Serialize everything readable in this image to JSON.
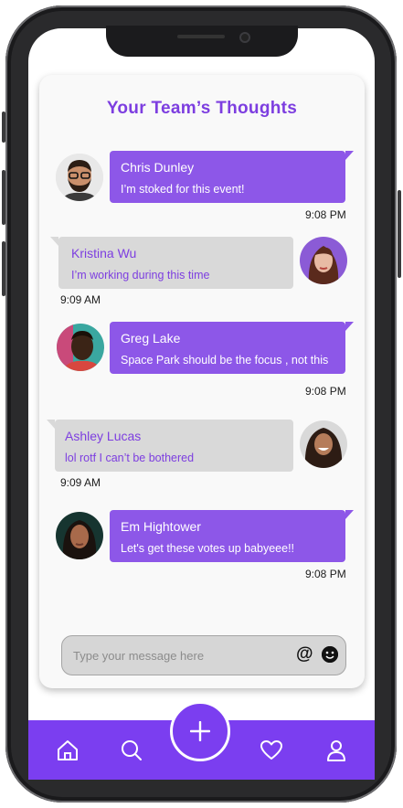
{
  "header": {
    "title": "Your Team’s Thoughts"
  },
  "messages": [
    {
      "sender": "Chris Dunley",
      "text": "I’m stoked for this event!",
      "time": "9:08 PM",
      "side": "left-avatar",
      "style": "purple"
    },
    {
      "sender": "Kristina Wu",
      "text": "I’m working during this time",
      "time": "9:09 AM",
      "side": "right-avatar",
      "style": "gray"
    },
    {
      "sender": "Greg Lake",
      "text": "Space Park should be the focus , not this",
      "time": "9:08 PM",
      "side": "left-avatar",
      "style": "purple"
    },
    {
      "sender": "Ashley Lucas",
      "text": "lol rotf I can’t be bothered",
      "time": "9:09 AM",
      "side": "right-avatar",
      "style": "gray"
    },
    {
      "sender": "Em Hightower",
      "text": "Let's get these votes up babyeee!!",
      "time": "9:08 PM",
      "side": "left-avatar",
      "style": "purple"
    }
  ],
  "composer": {
    "placeholder": "Type your message here",
    "mention_icon": "at-icon",
    "emoji_icon": "emoji-icon"
  },
  "nav": {
    "items": [
      "home-icon",
      "search-icon",
      "add-icon",
      "heart-icon",
      "profile-icon"
    ]
  },
  "colors": {
    "accent": "#7b3ef0",
    "bubble_purple": "#8d57e8",
    "bubble_gray": "#d9d9d9",
    "title": "#7d3ee0"
  }
}
